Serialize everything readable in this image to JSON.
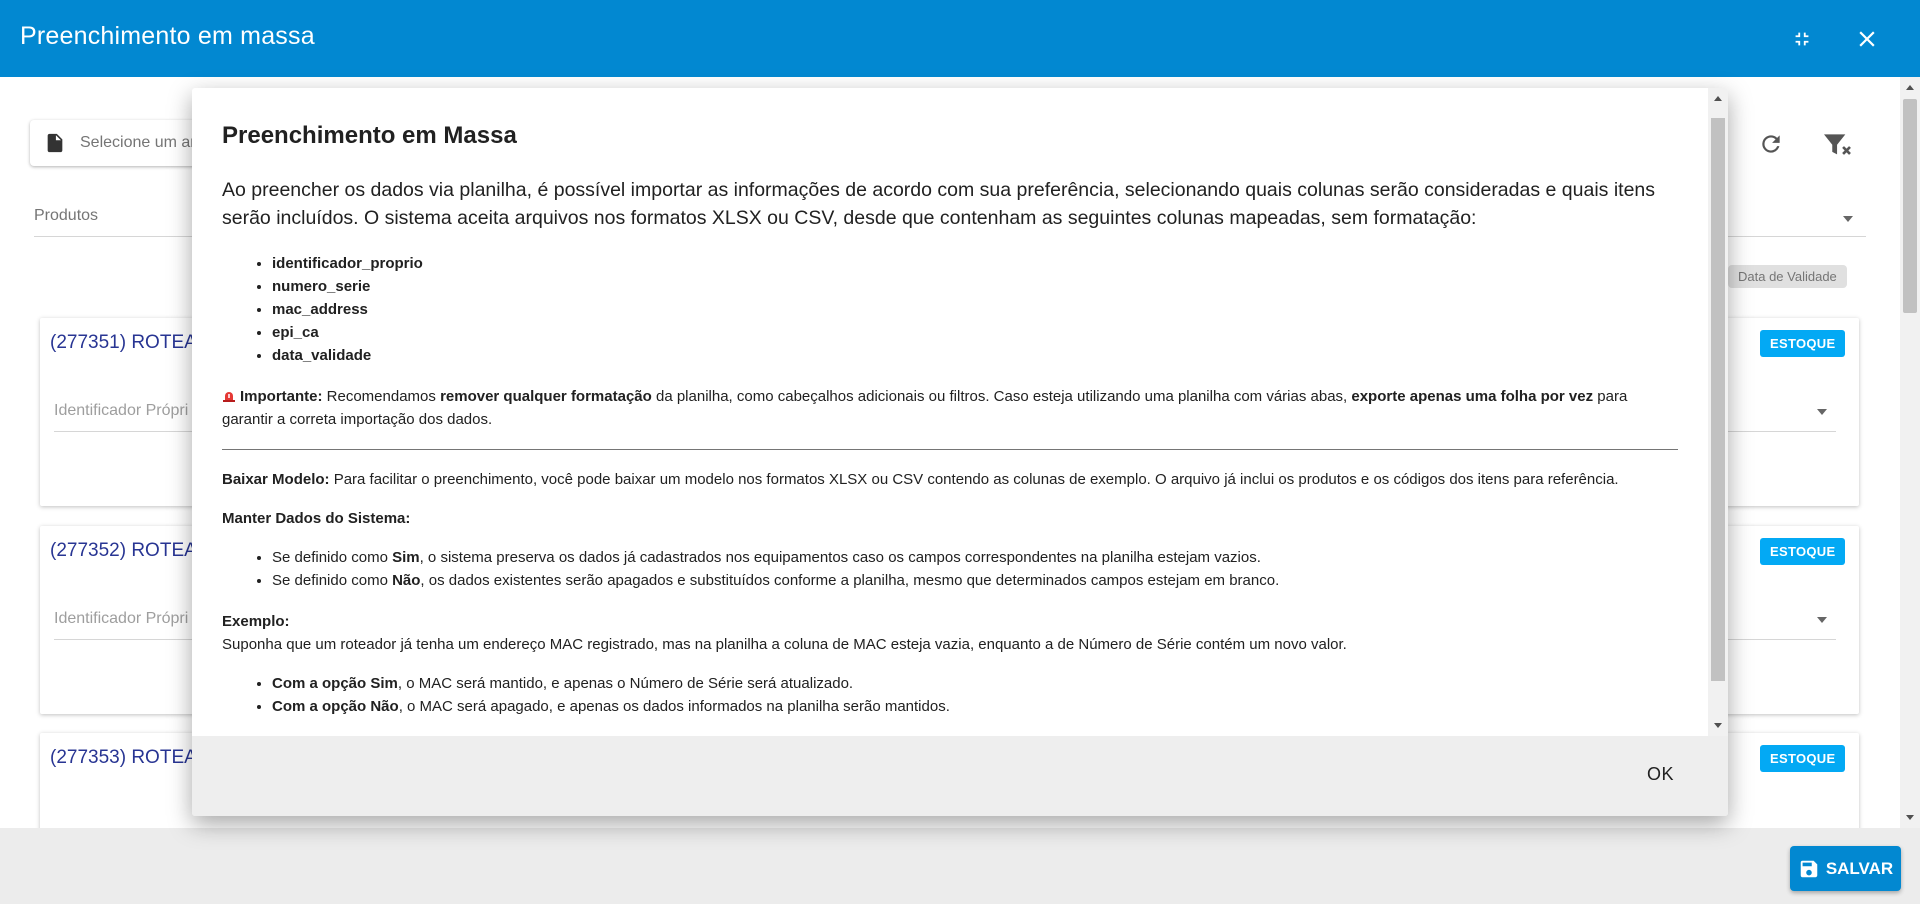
{
  "appbar": {
    "title": "Preenchimento em massa",
    "bg_color": "#0288d1"
  },
  "background": {
    "file_input_placeholder": "Selecione um ar",
    "produtos_label": "Produtos",
    "chip_validade": "Data de Validade",
    "cards": [
      {
        "title": "(277351) ROTEA",
        "badge": "ESTOQUE",
        "field_label": "Identificador Própri"
      },
      {
        "title": "(277352) ROTEA",
        "badge": "ESTOQUE",
        "field_label": "Identificador Própri"
      },
      {
        "title": "(277353) ROTEA",
        "badge": "ESTOQUE"
      }
    ]
  },
  "footer": {
    "save_label": "SALVAR"
  },
  "dialog": {
    "title": "Preenchimento em Massa",
    "intro": "Ao preencher os dados via planilha, é possível importar as informações de acordo com sua preferência, selecionando quais colunas serão consideradas e quais itens serão incluídos. O sistema aceita arquivos nos formatos XLSX ou CSV, desde que contenham as seguintes colunas mapeadas, sem formatação:",
    "columns": [
      "identificador_proprio",
      "numero_serie",
      "mac_address",
      "epi_ca",
      "data_validade"
    ],
    "important": {
      "label": "Importante:",
      "t1": " Recomendamos ",
      "b1": "remover qualquer formatação",
      "t2": " da planilha, como cabeçalhos adicionais ou filtros. Caso esteja utilizando uma planilha com várias abas, ",
      "b2": "exporte apenas uma folha por vez",
      "t3": " para garantir a correta importação dos dados."
    },
    "baixar": {
      "label": "Baixar Modelo:",
      "text": " Para facilitar o preenchimento, você pode baixar um modelo nos formatos XLSX ou CSV contendo as colunas de exemplo. O arquivo já inclui os produtos e os códigos dos itens para referência."
    },
    "manter": {
      "label": "Manter Dados do Sistema:",
      "items": [
        {
          "pre": "Se definido como ",
          "bold": "Sim",
          "post": ", o sistema preserva os dados já cadastrados nos equipamentos caso os campos correspondentes na planilha estejam vazios."
        },
        {
          "pre": "Se definido como ",
          "bold": "Não",
          "post": ", os dados existentes serão apagados e substituídos conforme a planilha, mesmo que determinados campos estejam em branco."
        }
      ]
    },
    "exemplo": {
      "label": "Exemplo:",
      "text": "Suponha que um roteador já tenha um endereço MAC registrado, mas na planilha a coluna de MAC esteja vazia, enquanto a de Número de Série contém um novo valor.",
      "items": [
        {
          "bold": "Com a opção Sim",
          "post": ", o MAC será mantido, e apenas o Número de Série será atualizado."
        },
        {
          "bold": "Com a opção Não",
          "post": ", o MAC será apagado, e apenas os dados informados na planilha serão mantidos."
        }
      ]
    },
    "ok_label": "OK"
  }
}
